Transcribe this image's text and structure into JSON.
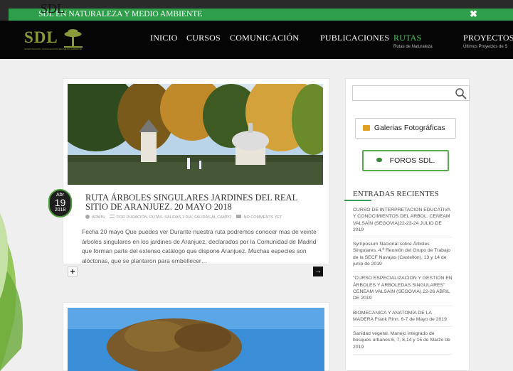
{
  "top_bar": {
    "site_abbr_overlay": "SDL",
    "tagline": "SDL EN NATURALEZA Y MEDIO AMBIENTE",
    "close_symbol": "✖"
  },
  "logo": {
    "text": "SDL",
    "subtitle": "INVESTIGACIÓN Y DIVULGACIÓN DEL MEDIO AMBIENTE"
  },
  "nav": {
    "items": [
      {
        "label": "INICIO",
        "sub": ""
      },
      {
        "label": "CURSOS",
        "sub": ""
      },
      {
        "label": "COMUNICACIÓN",
        "sub": ""
      },
      {
        "label": "PUBLICACIONES",
        "sub": ""
      },
      {
        "label": "RUTAS",
        "sub": "Rutas de Naturaleza"
      },
      {
        "label": "PROYECTOS",
        "sub": "Últimos Proyectos de S"
      }
    ],
    "active_color": "#4ecb5e"
  },
  "post": {
    "date": {
      "month": "Abr",
      "day": "19",
      "year": "2018"
    },
    "title": "RUTA ÁRBOLES SINGULARES JARDINES DEL REAL SITIO DE ARANJUEZ. 20 MAYO 2018",
    "meta": {
      "author": "ADMIN",
      "categories": "POR DURACIÓN, RUTAS, SALIDAS 1 DIA, SALIDAS AL CAMPO",
      "comments": "NO COMMENTS YET"
    },
    "excerpt": "Fecha 20 mayo Que puedes ver Durante nuestra ruta podremos conocer mas de veinte árboles singulares en los jardines de Aranjuez, declarados por la Comunidad de Madrid que forman parte del extenso catálogo que dispone Aranjuez. Muchas especies son alóctonas, que se plantaron para embellecer…",
    "plus_symbol": "+",
    "arrow_symbol": "→"
  },
  "sidebar": {
    "search_placeholder": "",
    "gallery_button": "Galerias Fotográficas",
    "forum_button": "FOROS SDL.",
    "recent_heading": "ENTRADAS RECIENTES",
    "recent_items": [
      "CURSO DE INTERPRETACION EDUCATIVA Y CONOCIMIENTOS DEL ARBOL. CENEAM VALSAÍN (SEGOVIA)22-23-24 JULIO DE 2019",
      "Symposium Nacional sobre Árboles Singulares. 4.ª Reunión del Grupo de Trabajo de la SECF Navajas (Castellón), 13 y 14 de junio de 2019",
      "\"CURSO ESPECIALIZACION Y GESTION EN ÁRBOLES Y ARBOLEDAS SINGULARES\" CENEAM VALSAÍN (SEGOVIA) 22-26 ABRIL DE 2019",
      "BIOMECANICA Y ANATOMÍA DE LA MADERA Frank Rinn. 6-7 de Mayo de 2019",
      "Sanidad vegetal. Manejo integrado de bosques urbanos.6, 7, 8,14 y 15 de Marzo de 2019"
    ]
  },
  "colors": {
    "green_bar": "#2e9e4a",
    "nav_bg": "#050505",
    "accent": "#3a9a5a"
  }
}
